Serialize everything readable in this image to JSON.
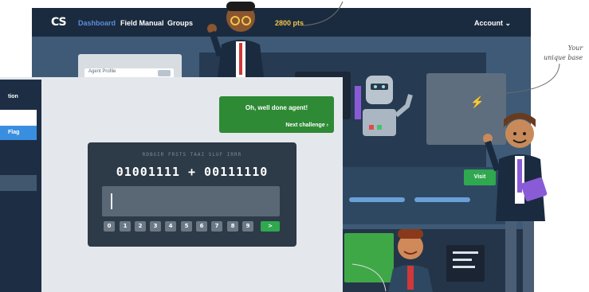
{
  "app": {
    "logo": "CS",
    "nav": [
      "Dashboard",
      "Field Manual",
      "Groups"
    ],
    "points": "2800 pts",
    "account": "Account",
    "colors": {
      "topbar": "#1b2b3f",
      "accent": "#5b8dd8",
      "points": "#f2c54a",
      "success": "#2e8a34"
    }
  },
  "profile_card": {
    "label": "Agent Profile"
  },
  "sidebar": {
    "title": "tion",
    "active_item": "Flag"
  },
  "puzzle": {
    "cipher_hint": "RDBGIR FRSTS TAAI SLUF IRRR",
    "equation": "01001111 + 00111110",
    "keypad": [
      "0",
      "1",
      "2",
      "3",
      "4",
      "5",
      "6",
      "7",
      "8",
      "9"
    ],
    "submit_icon": "chevron-right-icon"
  },
  "notification": {
    "message": "Oh, well done agent!",
    "link": "Next challenge ›"
  },
  "base": {
    "visit_label": "Visit"
  },
  "annotation": {
    "line1": "Your",
    "line2": "unique base"
  }
}
